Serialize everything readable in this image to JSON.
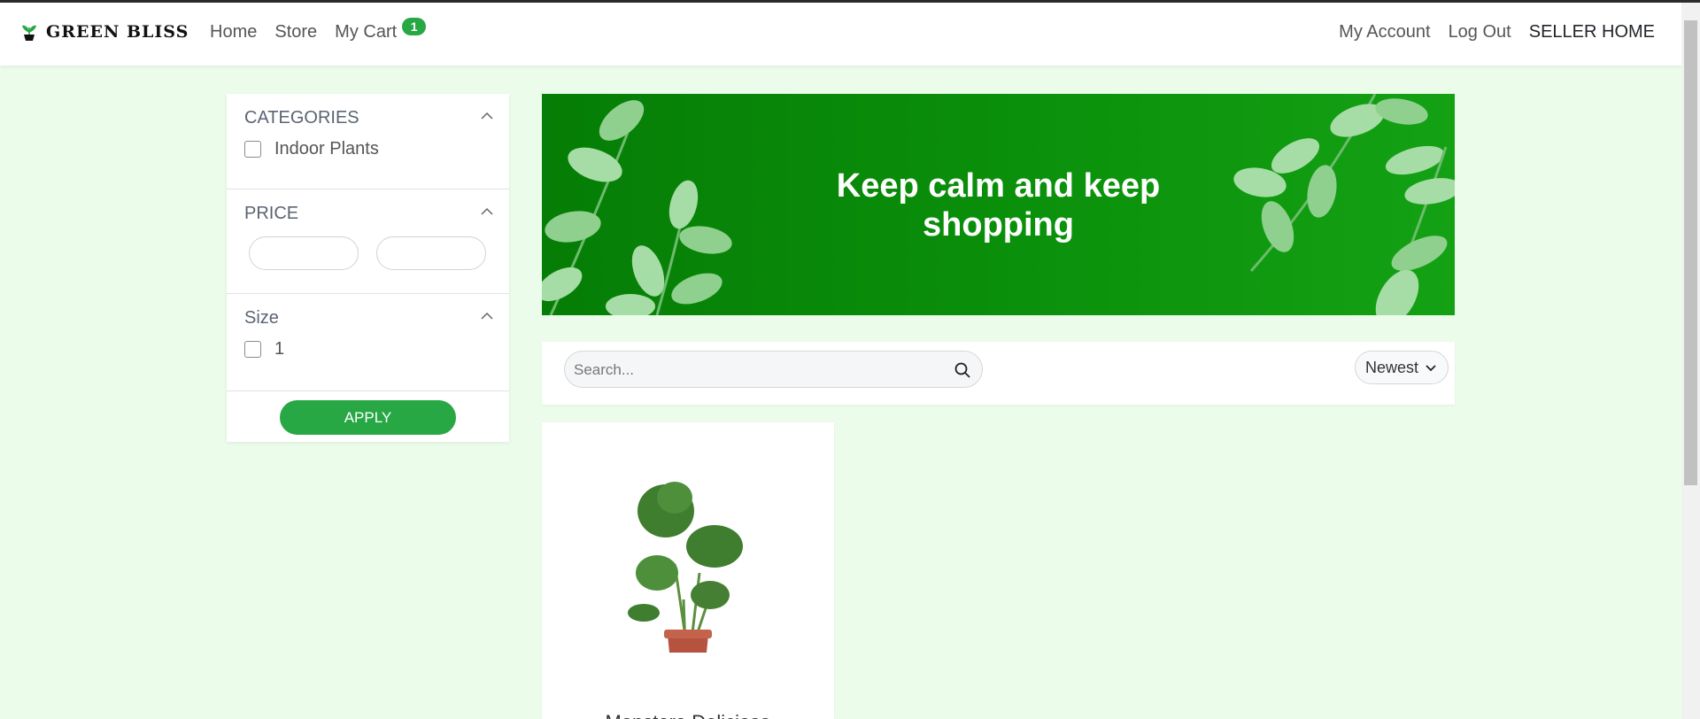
{
  "brand": {
    "name": "GREEN BLISS",
    "accent": "#28a745"
  },
  "nav": {
    "links": [
      {
        "label": "Home"
      },
      {
        "label": "Store"
      },
      {
        "label": "My Cart"
      }
    ],
    "cart_count": "1",
    "right_links": [
      {
        "label": "My Account"
      },
      {
        "label": "Log Out"
      },
      {
        "label": "SELLER HOME"
      }
    ]
  },
  "sidebar": {
    "categories": {
      "title": "CATEGORIES",
      "options": [
        {
          "label": "Indoor Plants",
          "checked": false
        }
      ]
    },
    "price": {
      "title": "PRICE",
      "min_value": "",
      "max_value": ""
    },
    "size": {
      "title": "Size",
      "options": [
        {
          "label": "1",
          "checked": false
        }
      ]
    },
    "apply_label": "APPLY"
  },
  "banner": {
    "line1": "Keep calm and keep",
    "line2": "shopping"
  },
  "toolbar": {
    "search_placeholder": "Search...",
    "sort_label": "Newest"
  },
  "products": [
    {
      "name": "Monstera Deliciosa"
    }
  ]
}
